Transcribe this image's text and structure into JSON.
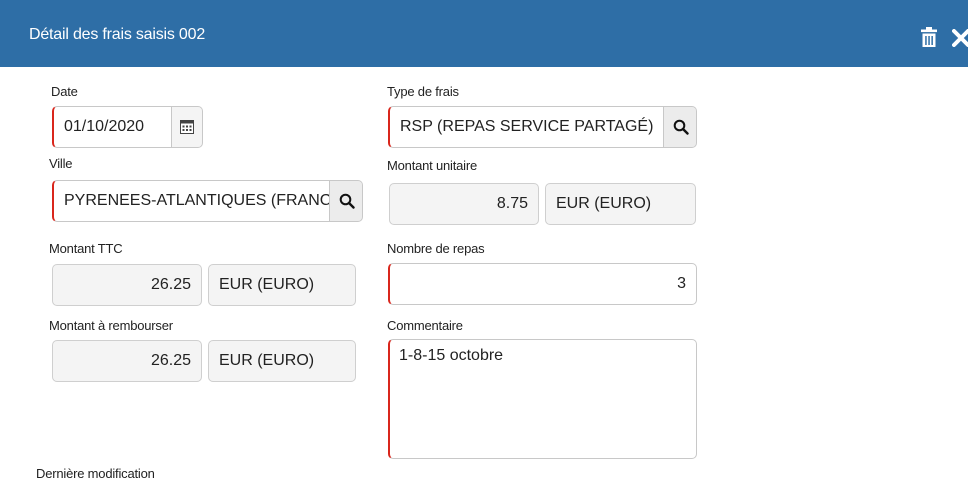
{
  "header": {
    "title": "Détail des frais saisis 002",
    "trash_icon": "trash-icon",
    "close_icon": "close-icon",
    "bg_color": "#2e6ea6"
  },
  "form": {
    "date": {
      "label": "Date",
      "value": "01/10/2020",
      "icon": "calendar-icon"
    },
    "type_frais": {
      "label": "Type de frais",
      "value": "RSP (REPAS SERVICE PARTAGÉ)",
      "icon": "search-icon"
    },
    "ville": {
      "label": "Ville",
      "value": "PYRENEES-ATLANTIQUES (FRANCI",
      "icon": "search-icon"
    },
    "montant_unitaire": {
      "label": "Montant unitaire",
      "amount": "8.75",
      "currency": "EUR (EURO)"
    },
    "montant_ttc": {
      "label": "Montant TTC",
      "amount": "26.25",
      "currency": "EUR (EURO)"
    },
    "nombre_repas": {
      "label": "Nombre de repas",
      "value": "3"
    },
    "montant_rembourser": {
      "label": "Montant à rembourser",
      "amount": "26.25",
      "currency": "EUR (EURO)"
    },
    "commentaire": {
      "label": "Commentaire",
      "value": "1-8-15 octobre"
    },
    "derniere_modification": {
      "label": "Dernière modification"
    }
  },
  "colors": {
    "required_border": "#d9261c",
    "readonly_bg": "#f4f4f4"
  }
}
